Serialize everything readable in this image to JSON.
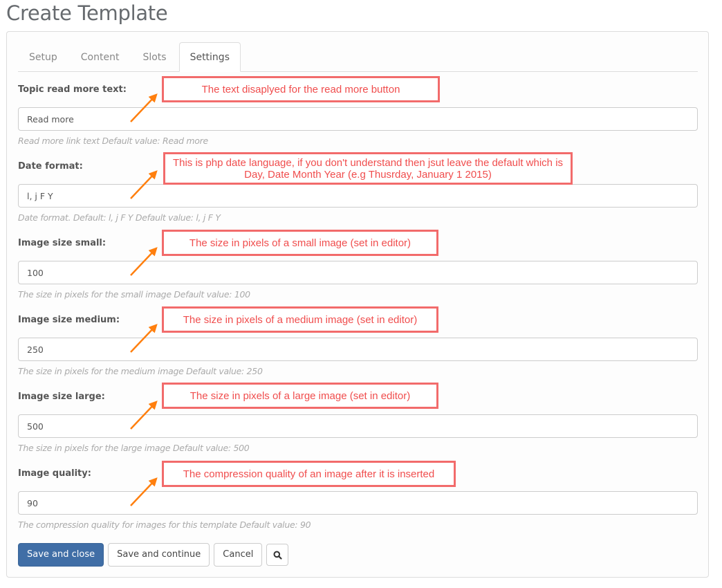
{
  "page": {
    "title": "Create Template"
  },
  "tabs": [
    {
      "label": "Setup",
      "active": false
    },
    {
      "label": "Content",
      "active": false
    },
    {
      "label": "Slots",
      "active": false
    },
    {
      "label": "Settings",
      "active": true
    }
  ],
  "fields": [
    {
      "label": "Topic read more text:",
      "value": "Read more",
      "help": "Read more link text Default value: Read more",
      "annotation": "The text disaplyed for the read more button"
    },
    {
      "label": "Date format:",
      "value": "l, j F Y",
      "help": "Date format. Default: l, j F Y Default value: l, j F Y",
      "annotation": "This is php date language, if you don't understand then jsut leave the default which is Day, Date Month Year (e.g Thusrday, January 1 2015)"
    },
    {
      "label": "Image size small:",
      "value": "100",
      "help": "The size in pixels for the small image Default value: 100",
      "annotation": "The size in pixels of a small image (set in editor)"
    },
    {
      "label": "Image size medium:",
      "value": "250",
      "help": "The size in pixels for the medium image Default value: 250",
      "annotation": "The size in pixels of a medium image (set in editor)"
    },
    {
      "label": "Image size large:",
      "value": "500",
      "help": "The size in pixels for the large image Default value: 500",
      "annotation": "The size in pixels of a large image (set in editor)"
    },
    {
      "label": "Image quality:",
      "value": "90",
      "help": "The compression quality for images for this template Default value: 90",
      "annotation": "The compression quality of an image after it is inserted"
    }
  ],
  "buttons": {
    "save_close": "Save and close",
    "save_continue": "Save and continue",
    "cancel": "Cancel",
    "search_icon": "search-icon"
  },
  "colors": {
    "primary": "#406ea6",
    "annotation": "#f26b6b",
    "arrow": "#ff7f0e"
  }
}
